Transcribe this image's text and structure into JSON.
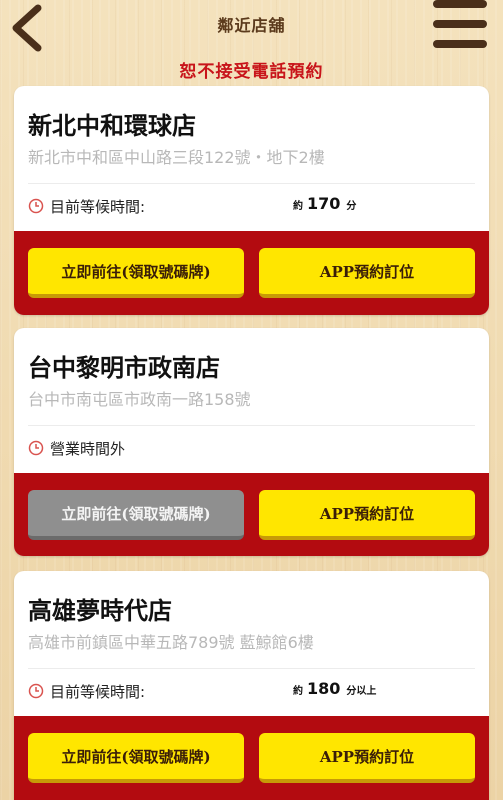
{
  "header": {
    "title": "鄰近店舖",
    "back_icon": "chevron-left-icon",
    "menu_icon": "hamburger-menu-icon",
    "notice": "恕不接受電話預約"
  },
  "colors": {
    "accent_red": "#b30b10",
    "button_yellow": "#ffe600",
    "button_disabled": "#8f8f8f",
    "notice_red": "#c8141a"
  },
  "stores": [
    {
      "name": "新北中和環球店",
      "address": "新北市中和區中山路三段122號・地下2樓",
      "status_label": "目前等候時間:",
      "wait_prefix": "約",
      "wait_minutes": "170",
      "wait_unit": "分",
      "go_button": "立即前往(領取號碼牌)",
      "go_enabled": true,
      "app_button": "APP預約訂位"
    },
    {
      "name": "台中黎明市政南店",
      "address": "台中市南屯區市政南一路158號",
      "status_label": "營業時間外",
      "go_button": "立即前往(領取號碼牌)",
      "go_enabled": false,
      "app_button": "APP預約訂位"
    },
    {
      "name": "高雄夢時代店",
      "address": "高雄市前鎮區中華五路789號 藍鯨館6樓",
      "status_label": "目前等候時間:",
      "wait_prefix": "約",
      "wait_minutes": "180",
      "wait_unit": "分以上",
      "go_button": "立即前往(領取號碼牌)",
      "go_enabled": true,
      "app_button": "APP預約訂位"
    }
  ]
}
